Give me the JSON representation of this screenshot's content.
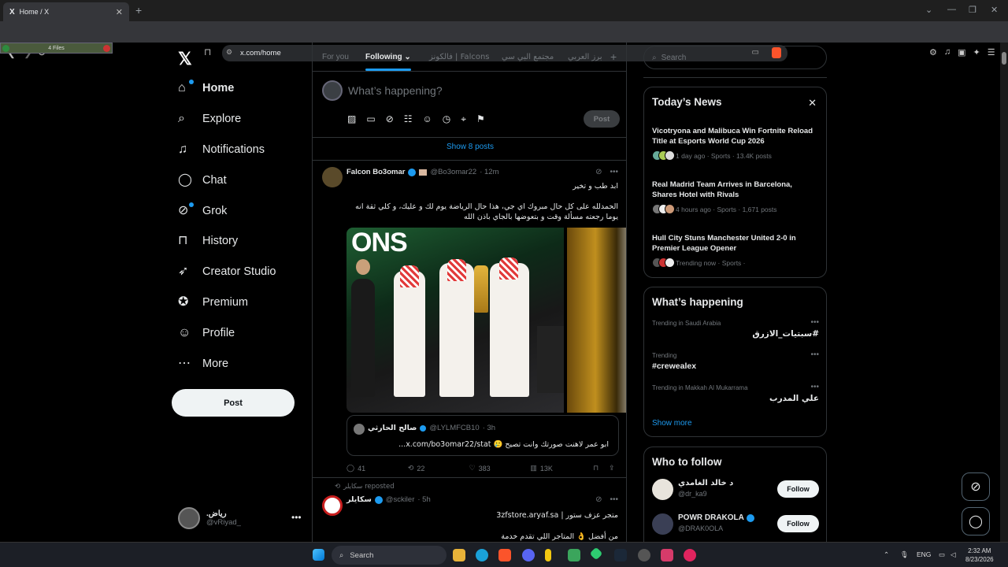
{
  "browser": {
    "tab_title": "Home / X",
    "tab_favicon": "X",
    "url": "x.com/home",
    "files_bar": "4 Files"
  },
  "nav": {
    "items": [
      {
        "label": "Home",
        "icon": "home-icon"
      },
      {
        "label": "Explore",
        "icon": "search-icon"
      },
      {
        "label": "Notifications",
        "icon": "bell-icon"
      },
      {
        "label": "Chat",
        "icon": "chat-bubble-icon"
      },
      {
        "label": "Grok",
        "icon": "grok-icon"
      },
      {
        "label": "History",
        "icon": "bookmark-icon"
      },
      {
        "label": "Creator Studio",
        "icon": "rocket-icon"
      },
      {
        "label": "Premium",
        "icon": "verified-badge-icon"
      },
      {
        "label": "Profile",
        "icon": "person-icon"
      },
      {
        "label": "More",
        "icon": "more-circle-icon"
      }
    ],
    "post_label": "Post",
    "account": {
      "name": ".رياض",
      "handle": "@vRiyad_"
    }
  },
  "feed": {
    "tabs": [
      "For you",
      "Following",
      "فالكونز | Falcons",
      "مجتمع البي سي",
      "برز العربي"
    ],
    "composer_placeholder": "What’s happening?",
    "composer_post": "Post",
    "show_posts": "Show 8 posts",
    "tweet1": {
      "name": "Falcon Bo3omar",
      "handle": "@Bo3omar22",
      "time": "· 12m",
      "line1": "ابد طب و تخير",
      "line2": "الحمدلله على كل حال مبروك اي جي، هذا حال الرياضة يوم لك و عليك، و كلي ثقة انه يوما رجعته مسألة وقت و بتعوضها بالجاي باذن الله",
      "photo_text": "ONS",
      "quote": {
        "name": "صالح الحارثي",
        "handle": "@LYLMFCB10",
        "time": "· 3h",
        "text": "ابو عمر لاهنت صورتك وانت تصيح 🥲 x.com/bo3omar22/stat..."
      },
      "stats": {
        "replies": "41",
        "reposts": "22",
        "likes": "383",
        "views": "13K"
      }
    },
    "tweet2": {
      "reposted_by": "سكايلر reposted",
      "name": "سكايلر",
      "handle": "@sckiler",
      "time": "· 5h",
      "line1": "متجر عزف ستور | 3zfstore.aryaf.sa",
      "line2": "من أفضل 👌 المتاجر اللي تقدم خدمة"
    }
  },
  "sidebar": {
    "search_placeholder": "Search",
    "news_title": "Today’s News",
    "news": [
      {
        "headline": "Vicotryona and Malibuca Win Fortnite Reload Title at Esports World Cup 2026",
        "meta": "1 day ago · Sports · 13.4K posts"
      },
      {
        "headline": "Real Madrid Team Arrives in Barcelona, Shares Hotel with Rivals",
        "meta": "4 hours ago · Sports · 1,671 posts"
      },
      {
        "headline": "Hull City Stuns Manchester United 2-0 in Premier League Opener",
        "meta": "Trending now · Sports ·"
      }
    ],
    "happening_title": "What’s happening",
    "trends": [
      {
        "category": "Trending in Saudi Arabia",
        "name": "#سبتيات_الازرق",
        "rtl": true
      },
      {
        "category": "Trending",
        "name": "#crewealex",
        "rtl": false
      },
      {
        "category": "Trending in Makkah Al Mukarrama",
        "name": "علي المدرب",
        "rtl": true
      }
    ],
    "show_more": "Show more",
    "follow_title": "Who to follow",
    "follow": [
      {
        "name": "د خالد الغامدي",
        "handle": "@dr_ka9",
        "button": "Follow"
      },
      {
        "name": "POWR DRAKOLA",
        "handle": "@DRAK0OLA",
        "button": "Follow"
      }
    ]
  },
  "taskbar": {
    "search": "Search",
    "lang": "ENG",
    "time": "2:32 AM",
    "date": "8/23/2026"
  },
  "colors": {
    "accent": "#1d9bf0",
    "bg": "#000000",
    "border": "#2f3336"
  }
}
